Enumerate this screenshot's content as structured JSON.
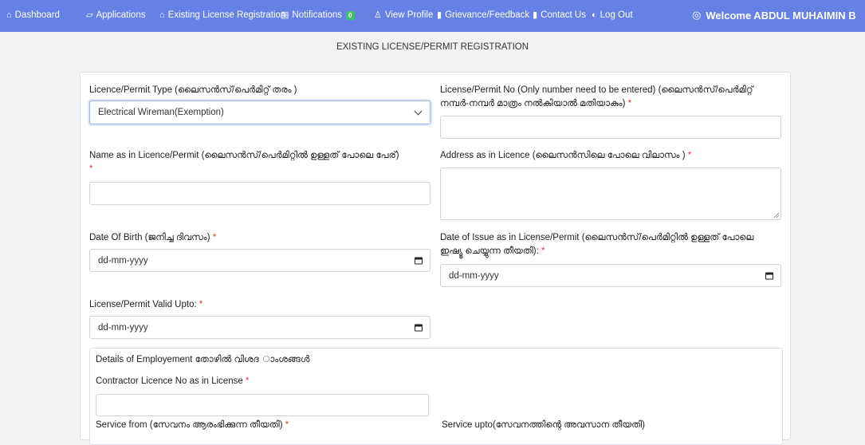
{
  "nav": {
    "dashboard": "Dashboard",
    "applications": "Applications",
    "existing": "Existing License Registration",
    "notifications": "Notifications",
    "notif_count": "0",
    "view_profile": "View Profile",
    "grievance": "Grievance/Feedback",
    "contact": "Contact Us",
    "logout": "Log Out",
    "welcome": "Welcome ABDUL MUHAIMIN B"
  },
  "page_title": "EXISTING LICENSE/PERMIT REGISTRATION",
  "form": {
    "licence_type_label": "Licence/Permit Type (ലൈസൻസ്/പെർമിറ്റ് തരം )",
    "licence_type_value": "Electrical Wireman(Exemption)",
    "licence_no_label_1": "License/Permit No (Only number need to be entered) (ലൈസൻസ്/പെർമിറ്റ്",
    "licence_no_label_2": "നമ്പർ-നമ്പർ മാത്രം നൽകിയാൽ മതിയാകും)",
    "name_label": "Name as in Licence/Permit (ലൈസൻസ്/പെർമിറ്റിൽ ഉള്ളത് പോലെ പേര്)",
    "address_label": "Address as in Licence (ലൈസൻസിലെ പോലെ വിലാസം )",
    "dob_label": "Date Of Birth (ജനിച്ച ദിവസം)",
    "dob_value": "dd-mm-yyyy",
    "issue_label_1": "Date of Issue as in License/Permit (ലൈസൻസ്/പെർമിറ്റിൽ ഉള്ളത് പോലെ",
    "issue_label_2": "ഇഷ്യൂ ചെയ്യുന്ന തീയതി):",
    "issue_value": "dd-mm-yyyy",
    "valid_label": "License/Permit Valid Upto:",
    "valid_value": "dd-mm-yyyy",
    "required_mark": "*"
  },
  "employment": {
    "title": "Details of Employement തോഴിൽ വിശദ ാംശങ്ങൾ",
    "contractor_label": "Contractor Licence No as in License",
    "service_from_label": "Service from (സേവനം ആരംഭിക്കുന്ന തീയതി)",
    "service_upto_label": "Service upto(സേവനത്തിന്റെ അവസാന തീയതി)"
  }
}
